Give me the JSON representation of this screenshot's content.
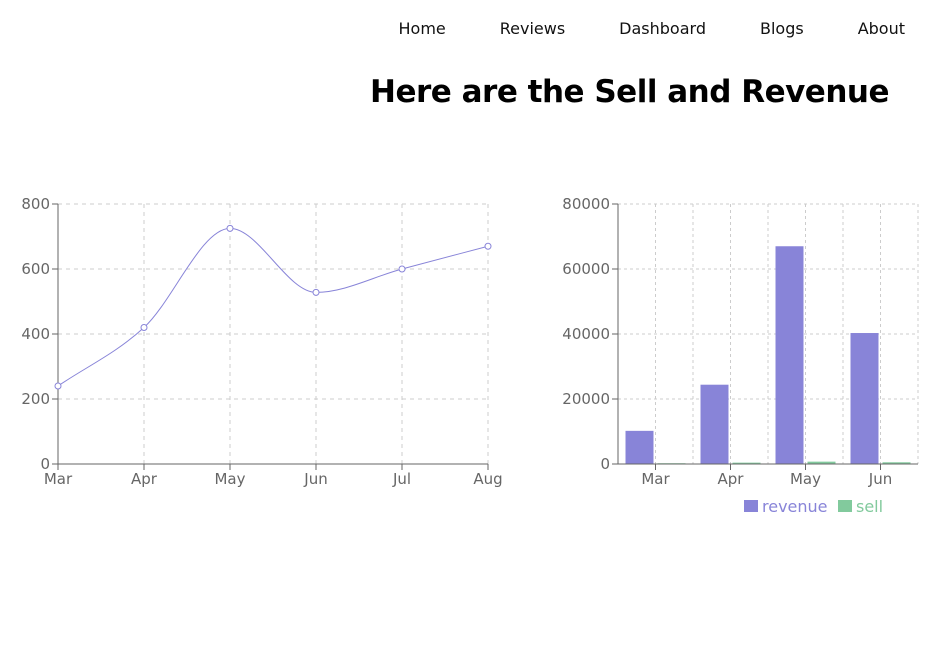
{
  "nav": {
    "items": [
      "Home",
      "Reviews",
      "Dashboard",
      "Blogs",
      "About"
    ]
  },
  "header": {
    "title": "Here are the Sell and Revenue"
  },
  "colors": {
    "line_stroke": "#8884d8",
    "revenue_bar": "#8884d8",
    "sell_bar": "#82ca9d",
    "grid": "#cccccc",
    "axis": "#666666"
  },
  "chart_data": [
    {
      "type": "line",
      "categories": [
        "Mar",
        "Apr",
        "May",
        "Jun",
        "Jul",
        "Aug"
      ],
      "series": [
        {
          "values": [
            240,
            420,
            725,
            528,
            600,
            670
          ]
        }
      ],
      "ylim": [
        0,
        800
      ],
      "yticks": [
        0,
        200,
        400,
        600,
        800
      ],
      "grid": true,
      "curve": "smooth"
    },
    {
      "type": "bar",
      "categories": [
        "Mar",
        "Apr",
        "May",
        "Jun"
      ],
      "series": [
        {
          "name": "revenue",
          "values": [
            10200,
            24400,
            67000,
            40300
          ]
        },
        {
          "name": "sell",
          "values": [
            240,
            420,
            725,
            528
          ]
        }
      ],
      "ylim": [
        0,
        80000
      ],
      "yticks": [
        0,
        20000,
        40000,
        60000,
        80000
      ],
      "grid": true,
      "legend": "bottom-right"
    }
  ]
}
